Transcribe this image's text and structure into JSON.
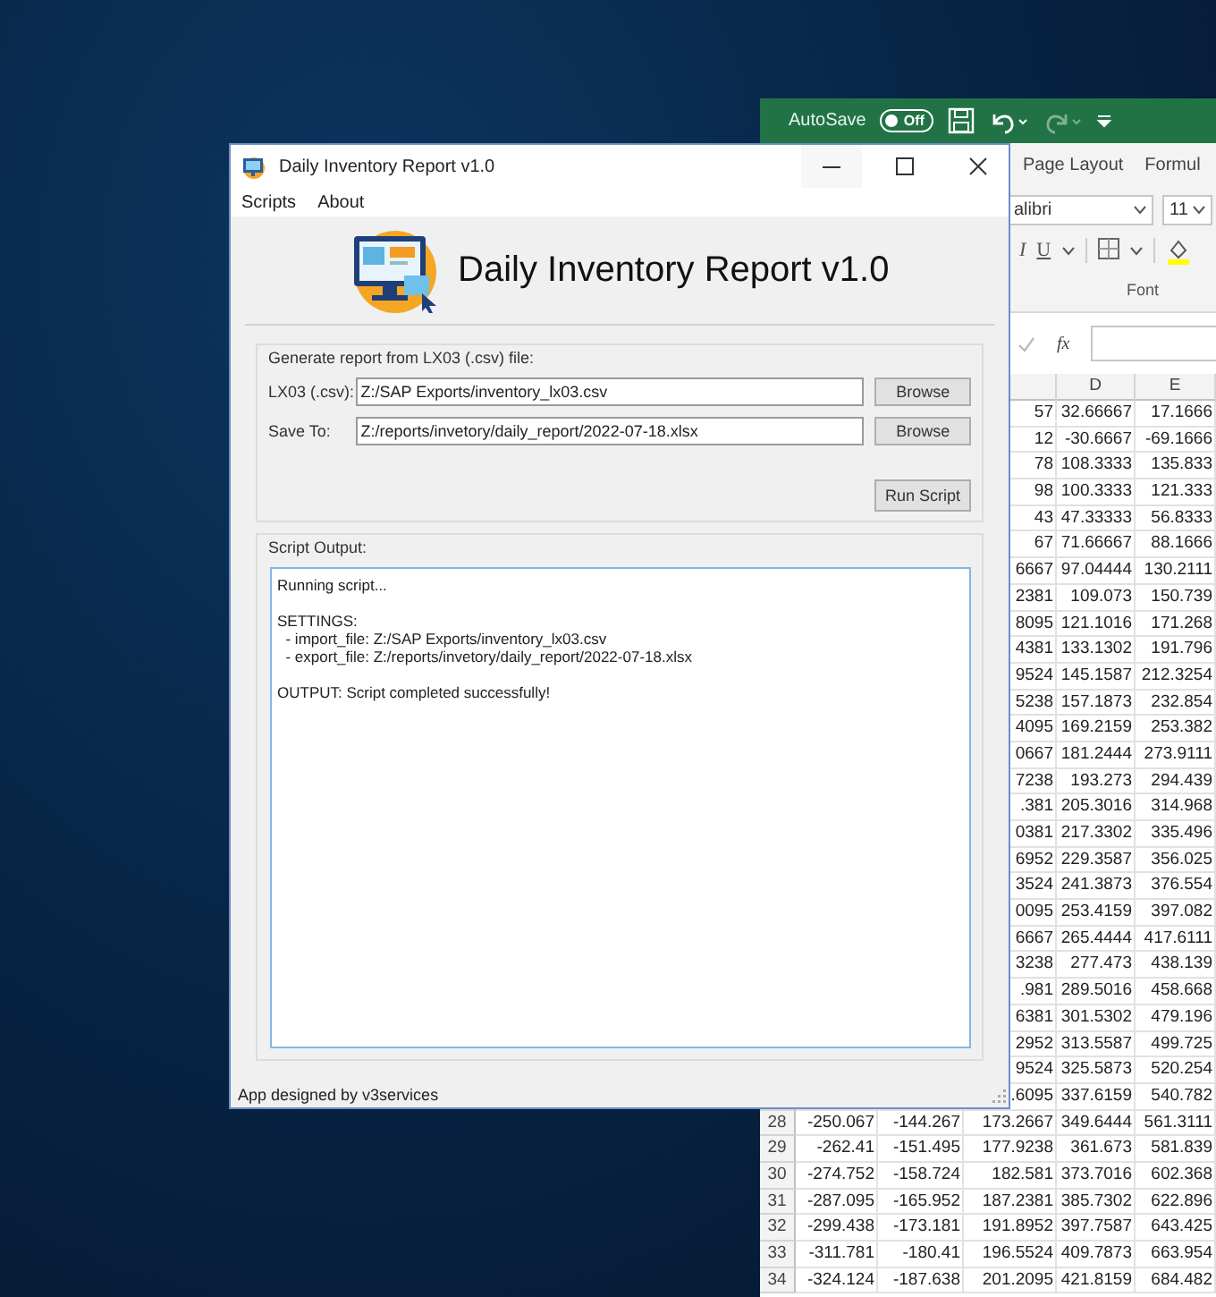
{
  "excel_window": {
    "autosave_label": "AutoSave",
    "autosave_toggle": {
      "label": "Off",
      "on": false
    },
    "ribbon_tabs": [
      "Page Layout",
      "Formul"
    ],
    "font_name": "alibri",
    "font_size": "11",
    "format_buttons": [
      "I",
      "U"
    ],
    "font_group_label": "Font",
    "formula_button": "fx",
    "column_headers": {
      "d": "D",
      "e": "E"
    },
    "rows": [
      {
        "c": "57",
        "d": "32.66667",
        "e": "17.1666"
      },
      {
        "c": "12",
        "d": "-30.6667",
        "e": "-69.1666"
      },
      {
        "c": "78",
        "d": "108.3333",
        "e": "135.833"
      },
      {
        "c": "98",
        "d": "100.3333",
        "e": "121.333"
      },
      {
        "c": "43",
        "d": "47.33333",
        "e": "56.8333"
      },
      {
        "c": "67",
        "d": "71.66667",
        "e": "88.1666"
      },
      {
        "c": "6667",
        "d": "97.04444",
        "e": "130.2111"
      },
      {
        "c": "2381",
        "d": "109.073",
        "e": "150.739"
      },
      {
        "c": "8095",
        "d": "121.1016",
        "e": "171.268"
      },
      {
        "c": "4381",
        "d": "133.1302",
        "e": "191.796"
      },
      {
        "c": "9524",
        "d": "145.1587",
        "e": "212.3254"
      },
      {
        "c": "5238",
        "d": "157.1873",
        "e": "232.854"
      },
      {
        "c": "4095",
        "d": "169.2159",
        "e": "253.382"
      },
      {
        "c": "0667",
        "d": "181.2444",
        "e": "273.9111"
      },
      {
        "c": "7238",
        "d": "193.273",
        "e": "294.439"
      },
      {
        "c": ".381",
        "d": "205.3016",
        "e": "314.968"
      },
      {
        "c": "0381",
        "d": "217.3302",
        "e": "335.496"
      },
      {
        "c": "6952",
        "d": "229.3587",
        "e": "356.025"
      },
      {
        "c": "3524",
        "d": "241.3873",
        "e": "376.554"
      },
      {
        "c": "0095",
        "d": "253.4159",
        "e": "397.082"
      },
      {
        "c": "6667",
        "d": "265.4444",
        "e": "417.6111"
      },
      {
        "c": "3238",
        "d": "277.473",
        "e": "438.139"
      },
      {
        "c": ".981",
        "d": "289.5016",
        "e": "458.668"
      },
      {
        "c": "6381",
        "d": "301.5302",
        "e": "479.196"
      },
      {
        "c": "2952",
        "d": "313.5587",
        "e": "499.725"
      },
      {
        "c": "9524",
        "d": "325.5873",
        "e": "520.254"
      },
      {
        "c": ".6095",
        "d": "337.6159",
        "e": "540.782"
      },
      {
        "row": "28",
        "a": "-250.067",
        "b": "-144.267",
        "c": "173.2667",
        "d": "349.6444",
        "e": "561.3111"
      },
      {
        "row": "29",
        "a": "-262.41",
        "b": "-151.495",
        "c": "177.9238",
        "d": "361.673",
        "e": "581.839"
      },
      {
        "row": "30",
        "a": "-274.752",
        "b": "-158.724",
        "c": "182.581",
        "d": "373.7016",
        "e": "602.368"
      },
      {
        "row": "31",
        "a": "-287.095",
        "b": "-165.952",
        "c": "187.2381",
        "d": "385.7302",
        "e": "622.896"
      },
      {
        "row": "32",
        "a": "-299.438",
        "b": "-173.181",
        "c": "191.8952",
        "d": "397.7587",
        "e": "643.425"
      },
      {
        "row": "33",
        "a": "-311.781",
        "b": "-180.41",
        "c": "196.5524",
        "d": "409.7873",
        "e": "663.954"
      },
      {
        "row": "34",
        "a": "-324.124",
        "b": "-187.638",
        "c": "201.2095",
        "d": "421.8159",
        "e": "684.482"
      }
    ]
  },
  "app_window": {
    "title": "Daily Inventory Report v1.0",
    "menu": [
      "Scripts",
      "About"
    ],
    "heading": "Daily Inventory Report v1.0",
    "input_group": {
      "title": "Generate report from LX03 (.csv) file:",
      "fields": [
        {
          "label": "LX03 (.csv):",
          "value": "Z:/SAP Exports/inventory_lx03.csv",
          "button": "Browse"
        },
        {
          "label": "Save To:",
          "value": "Z:/reports/invetory/daily_report/2022-07-18.xlsx",
          "button": "Browse"
        }
      ],
      "run_button": "Run Script"
    },
    "output_group": {
      "title": "Script Output:",
      "output": "Running script...\n\nSETTINGS:\n  - import_file: Z:/SAP Exports/inventory_lx03.csv\n  - export_file: Z:/reports/invetory/daily_report/2022-07-18.xlsx\n\nOUTPUT: Script completed successfully!"
    },
    "status": "App designed by v3services"
  }
}
